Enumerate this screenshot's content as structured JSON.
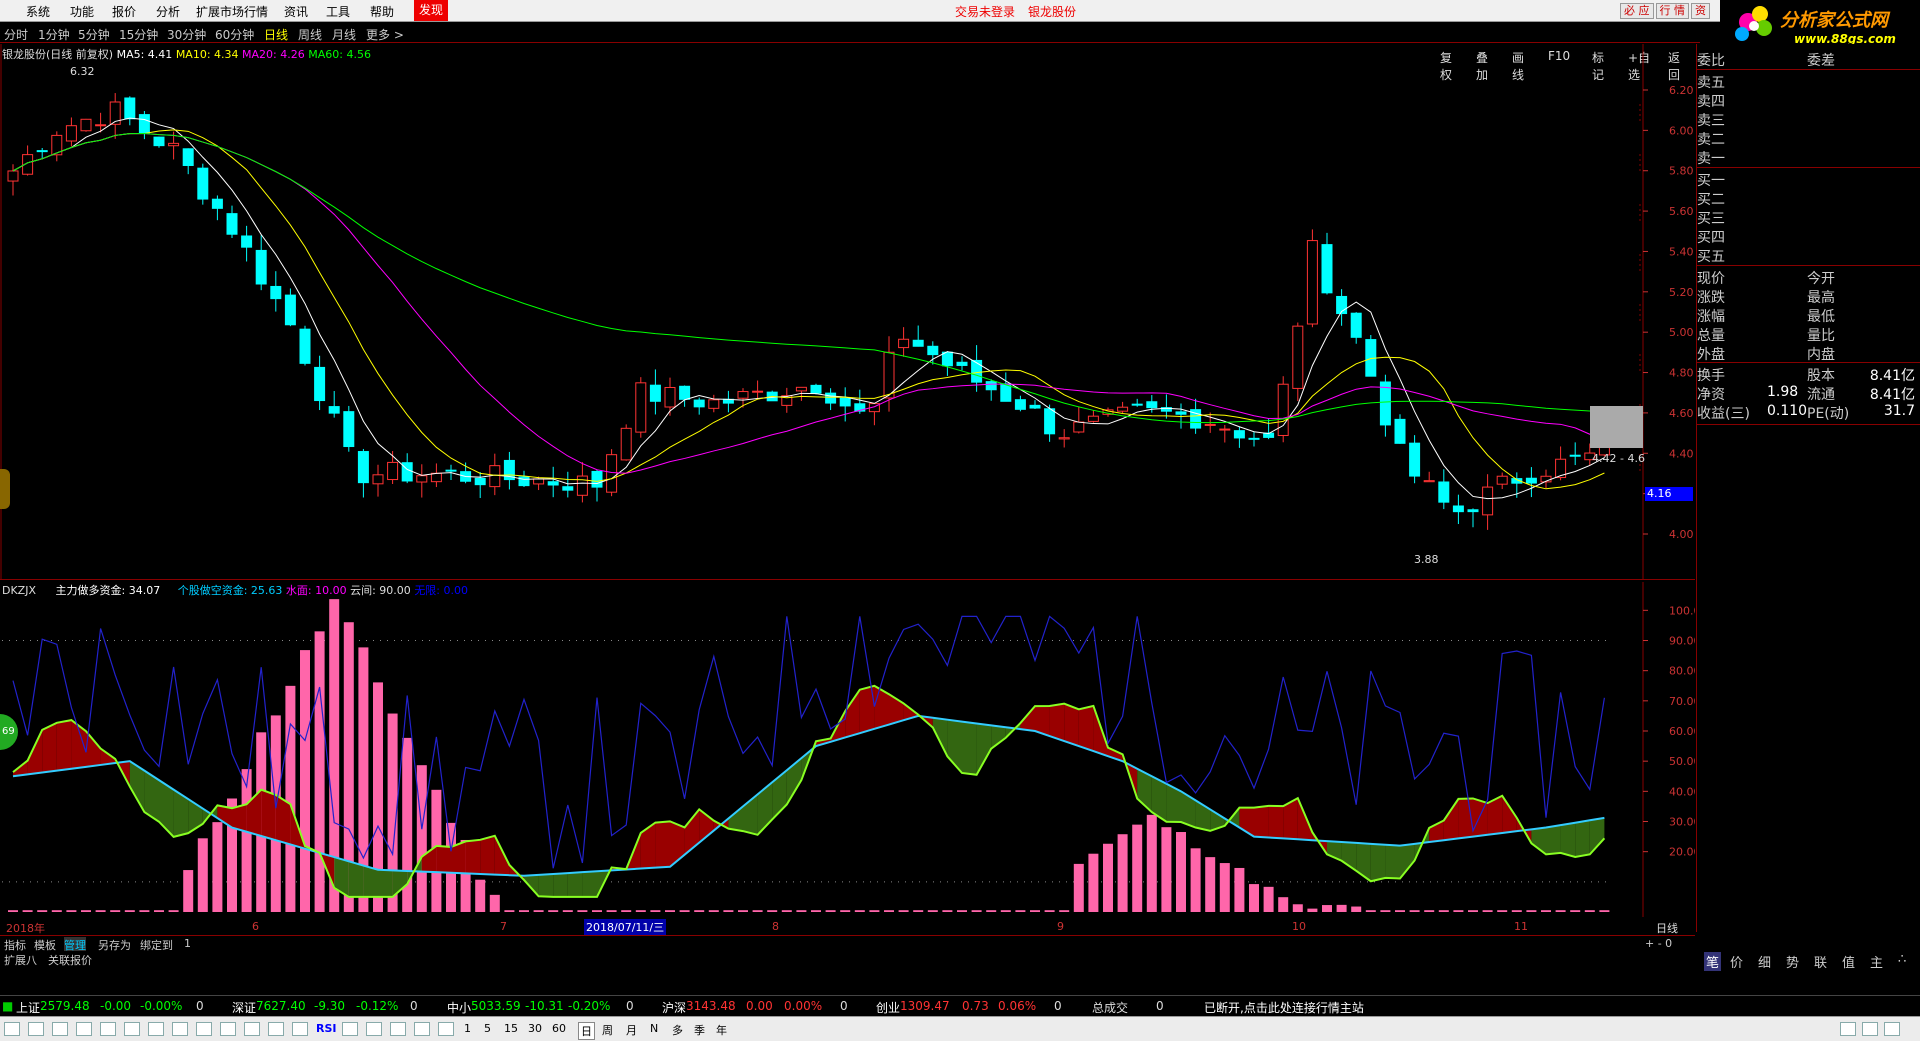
{
  "menubar": {
    "items": [
      "系统",
      "功能",
      "报价",
      "分析",
      "扩展市场行情",
      "资讯",
      "工具",
      "帮助"
    ],
    "fx_label": "发现",
    "trade_status": "交易未登录",
    "stock_name": "银龙股份"
  },
  "toptabs": [
    "必 应",
    "行 情",
    "资"
  ],
  "logo": {
    "title": "分析家公式网",
    "url_text": "www.88gs.com"
  },
  "periods": [
    "分时",
    "1分钟",
    "5分钟",
    "15分钟",
    "30分钟",
    "60分钟",
    "日线",
    "周线",
    "月线",
    "更多 >"
  ],
  "active_period": "日线",
  "charttools": [
    "复权",
    "叠加",
    "画线",
    "F10",
    "标记",
    "+自选",
    "返回"
  ],
  "main": {
    "title": "银龙股份(日线 前复权)",
    "ma5": "MA5: 4.41",
    "ma10": "MA10: 4.34",
    "ma20": "MA20: 4.26",
    "ma60": "MA60: 4.56",
    "high_label": "6.32",
    "low_label": "3.88",
    "range_label": "4.42 - 4.6",
    "price_tag": "4.16",
    "yticks": [
      "6.20",
      "6.00",
      "5.80",
      "5.60",
      "5.40",
      "5.20",
      "5.00",
      "4.80",
      "4.60",
      "4.40",
      "4.20",
      "4.00"
    ]
  },
  "indicator": {
    "name": "DKZJX",
    "zl": "主力做多资金: 34.07",
    "gg": "个股做空资金: 25.63",
    "sm": "水面: 10.00",
    "yj": "云间: 90.00",
    "wx": "无限: 0.00",
    "yticks": [
      "100.0",
      "90.00",
      "80.00",
      "70.00",
      "60.00",
      "50.00",
      "40.00",
      "30.00",
      "20.00"
    ],
    "circle_value": "69"
  },
  "xaxis": {
    "labels": [
      "2018年",
      "6",
      "7",
      "2018/07/11/三",
      "8",
      "9",
      "10",
      "11"
    ],
    "period": "日线"
  },
  "bottomtabs": [
    "指标",
    "模板",
    "管理",
    "另存为",
    "绑定到",
    "1"
  ],
  "exttabs": [
    "扩展八",
    "关联报价"
  ],
  "rightpanel": {
    "order_header": [
      "委比",
      "委差"
    ],
    "sells": [
      "卖五",
      "卖四",
      "卖三",
      "卖二",
      "卖一"
    ],
    "buys": [
      "买一",
      "买二",
      "买三",
      "买四",
      "买五"
    ],
    "quote_left": [
      "现价",
      "涨跌",
      "涨幅",
      "总量",
      "外盘"
    ],
    "quote_mid": [
      "今开",
      "最高",
      "最低",
      "量比",
      "内盘"
    ],
    "fin": [
      {
        "l": "换手",
        "m": "股本",
        "v": "8.41亿"
      },
      {
        "l": "净资",
        "m": "1.98",
        "v": "流通",
        "v2": "8.41亿"
      },
      {
        "l": "收益(三)",
        "m": "0.110",
        "v": "PE(动)",
        "v2": "31.7"
      }
    ],
    "tabs": [
      "笔",
      "价",
      "细",
      "势",
      "联",
      "值",
      "主",
      "∴"
    ],
    "plusminus": "+ - 0"
  },
  "indexbar": {
    "sh": {
      "name": "上证",
      "value": "2579.48",
      "chg": "-0.00",
      "pct": "-0.00%",
      "vol": "0"
    },
    "sz": {
      "name": "深证",
      "value": "7627.40",
      "chg": "-9.30",
      "pct": "-0.12%",
      "vol": "0"
    },
    "zx": {
      "name": "中小",
      "value": "5033.59",
      "chg": "-10.31",
      "pct": "-0.20%",
      "vol": "0"
    },
    "hs": {
      "name": "沪深",
      "value": "3143.48",
      "chg": "0.00",
      "pct": "0.00%",
      "vol": "0"
    },
    "cy": {
      "name": "创业",
      "value": "1309.47",
      "chg": "0.73",
      "pct": "0.06%",
      "vol": "0"
    },
    "total_label": "总成交",
    "total_value": "0",
    "status": "已断开,点击此处连接行情主站"
  },
  "toolbar_text": [
    "RSI",
    "1",
    "5",
    "15",
    "30",
    "60",
    "日",
    "周",
    "月",
    "N",
    "多",
    "季",
    "年"
  ]
}
